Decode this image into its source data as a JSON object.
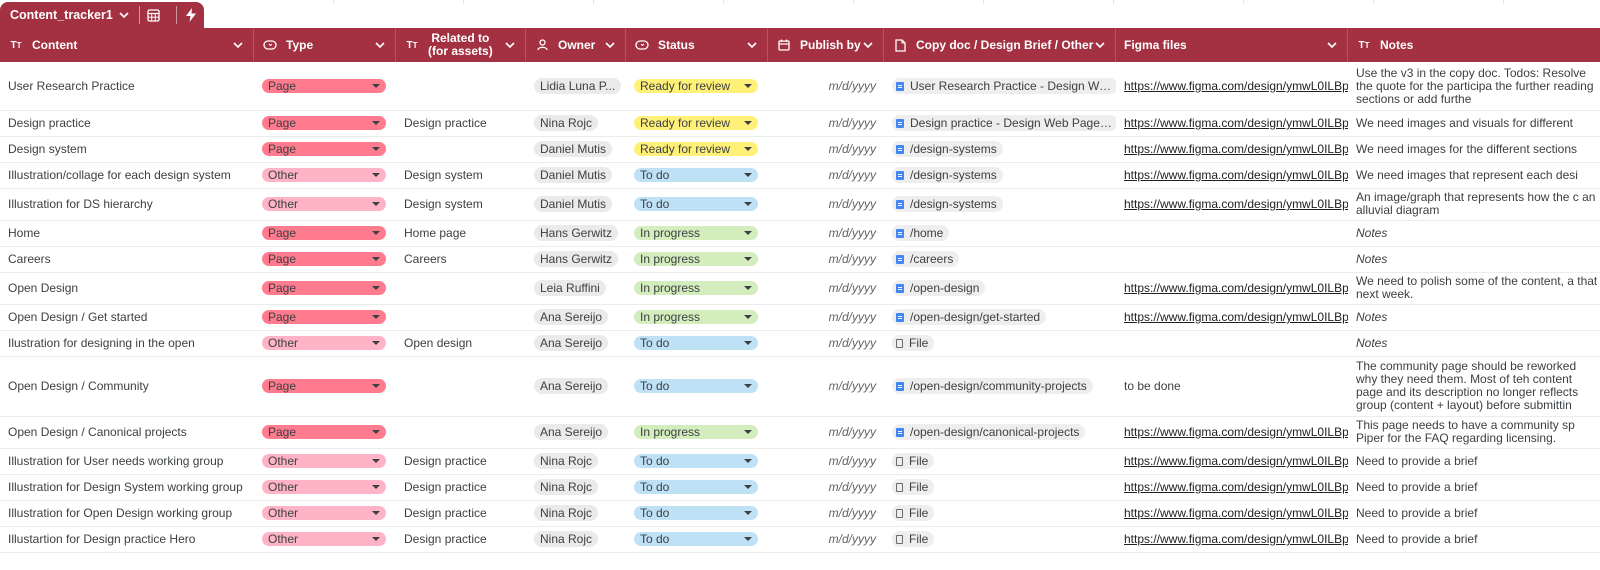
{
  "tab": {
    "name": "Content_tracker1",
    "chevron": "chevron-down",
    "icons": [
      "table-settings-icon",
      "bolt-icon"
    ]
  },
  "columns": [
    {
      "key": "content",
      "label": "Content",
      "icon": "text-type-icon"
    },
    {
      "key": "type",
      "label": "Type",
      "icon": "dropdown-chip-icon"
    },
    {
      "key": "related",
      "label": "Related to (for assets)",
      "label1": "Related to",
      "label2": "(for assets)",
      "icon": "text-type-icon"
    },
    {
      "key": "owner",
      "label": "Owner",
      "icon": "person-icon"
    },
    {
      "key": "status",
      "label": "Status",
      "icon": "dropdown-chip-icon"
    },
    {
      "key": "publish",
      "label": "Publish by",
      "icon": "calendar-icon"
    },
    {
      "key": "doc",
      "label": "Copy doc / Design Brief / Other",
      "icon": "document-icon"
    },
    {
      "key": "figma",
      "label": "Figma files",
      "icon": ""
    },
    {
      "key": "notes",
      "label": "Notes",
      "icon": "text-type-icon"
    }
  ],
  "type_colors": {
    "Page": "#ff7b8d",
    "Other": "#ffb3c6"
  },
  "status_colors": {
    "Ready for review": "#fff178",
    "To do": "#bfe1f6",
    "In progress": "#d4edbc"
  },
  "date_placeholder": "m/d/yyyy",
  "rows": [
    {
      "content": "User Research Practice",
      "type": "Page",
      "related": "",
      "owner": "Lidia Luna P...",
      "status": "Ready for review",
      "doc": "User Research Practice - Design We...",
      "doc_kind": "doc",
      "figma": "https://www.figma.com/design/ymwL0ILBp",
      "notes": "Use the v3 in the copy doc. Todos: Resolve the quote for the participa the further reading sections or add furthe",
      "notes_italic": false
    },
    {
      "content": "Design practice",
      "type": "Page",
      "related": "Design practice",
      "owner": "Nina Rojc",
      "status": "Ready for review",
      "doc": "Design practice - Design Web Page ...",
      "doc_kind": "doc",
      "figma": "https://www.figma.com/design/ymwL0ILBp",
      "notes": "We need images and visuals for different",
      "notes_italic": false
    },
    {
      "content": "Design system",
      "type": "Page",
      "related": "",
      "owner": "Daniel Mutis",
      "status": "Ready for review",
      "doc": "/design-systems",
      "doc_kind": "doc",
      "figma": "https://www.figma.com/design/ymwL0ILBp",
      "notes": "We need images for the different sections",
      "notes_italic": false
    },
    {
      "content": "Illustration/collage for each design system",
      "type": "Other",
      "related": "Design system",
      "owner": "Daniel Mutis",
      "status": "To do",
      "doc": "/design-systems",
      "doc_kind": "doc",
      "figma": "https://www.figma.com/design/ymwL0ILBp",
      "notes": "We need images that represent each desi",
      "notes_italic": false
    },
    {
      "content": "Illustration for DS hierarchy",
      "type": "Other",
      "related": "Design system",
      "owner": "Daniel Mutis",
      "status": "To do",
      "doc": "/design-systems",
      "doc_kind": "doc",
      "figma": "https://www.figma.com/design/ymwL0ILBp",
      "notes": "An image/graph that represents how the c an alluvial diagram",
      "notes_italic": false
    },
    {
      "content": "Home",
      "type": "Page",
      "related": "Home page",
      "owner": "Hans Gerwitz",
      "status": "In progress",
      "doc": "/home",
      "doc_kind": "doc",
      "figma": "",
      "notes": "Notes",
      "notes_italic": true
    },
    {
      "content": "Careers",
      "type": "Page",
      "related": "Careers",
      "owner": "Hans Gerwitz",
      "status": "In progress",
      "doc": "/careers",
      "doc_kind": "doc",
      "figma": "",
      "notes": "Notes",
      "notes_italic": true
    },
    {
      "content": "Open Design",
      "type": "Page",
      "related": "",
      "owner": "Leia Ruffini",
      "status": "In progress",
      "doc": "/open-design",
      "doc_kind": "doc",
      "figma": "https://www.figma.com/design/ymwL0ILBp",
      "notes": "We need to polish some of the content, a that next week.",
      "notes_italic": false
    },
    {
      "content": "Open Design / Get started",
      "type": "Page",
      "related": "",
      "owner": "Ana Sereijo",
      "status": "In progress",
      "doc": "/open-design/get-started",
      "doc_kind": "doc",
      "figma": "https://www.figma.com/design/ymwL0ILBp",
      "notes": "Notes",
      "notes_italic": true
    },
    {
      "content": "Ilustration for designing in the open",
      "type": "Other",
      "related": "Open design",
      "owner": "Ana Sereijo",
      "status": "To do",
      "doc": "File",
      "doc_kind": "file",
      "figma": "",
      "notes": "Notes",
      "notes_italic": true
    },
    {
      "content": "Open Design / Community",
      "type": "Page",
      "related": "",
      "owner": "Ana Sereijo",
      "status": "To do",
      "doc": "/open-design/community-projects",
      "doc_kind": "doc",
      "figma": "to be done",
      "figma_plain": true,
      "notes": "The community page should be reworked why they need them. Most of teh content page and its description no longer reflects group (content + layout) before submittin",
      "notes_italic": false
    },
    {
      "content": "Open Design / Canonical projects",
      "type": "Page",
      "related": "",
      "owner": "Ana Sereijo",
      "status": "In progress",
      "doc": "/open-design/canonical-projects",
      "doc_kind": "doc",
      "figma": "https://www.figma.com/design/ymwL0ILBp",
      "notes": "This page needs to have a community sp Piper for the FAQ regarding licensing.",
      "notes_italic": false
    },
    {
      "content": "Illustration for User needs working group",
      "type": "Other",
      "related": "Design practice",
      "owner": "Nina Rojc",
      "status": "To do",
      "doc": "File",
      "doc_kind": "file",
      "figma": "https://www.figma.com/design/ymwL0ILBp",
      "notes": "Need to provide a brief",
      "notes_italic": false
    },
    {
      "content": "Illustration for Design System working group",
      "type": "Other",
      "related": "Design practice",
      "owner": "Nina Rojc",
      "status": "To do",
      "doc": "File",
      "doc_kind": "file",
      "figma": "https://www.figma.com/design/ymwL0ILBp",
      "notes": "Need to provide a brief",
      "notes_italic": false
    },
    {
      "content": "Illustration for Open Design working group",
      "type": "Other",
      "related": "Design practice",
      "owner": "Nina Rojc",
      "status": "To do",
      "doc": "File",
      "doc_kind": "file",
      "figma": "https://www.figma.com/design/ymwL0ILBp",
      "notes": "Need to provide a brief",
      "notes_italic": false
    },
    {
      "content": "Illustartion for Design practice Hero",
      "type": "Other",
      "related": "Design practice",
      "owner": "Nina Rojc",
      "status": "To do",
      "doc": "File",
      "doc_kind": "file",
      "figma": "https://www.figma.com/design/ymwL0ILBp",
      "notes": "Need to provide a brief",
      "notes_italic": false
    }
  ]
}
